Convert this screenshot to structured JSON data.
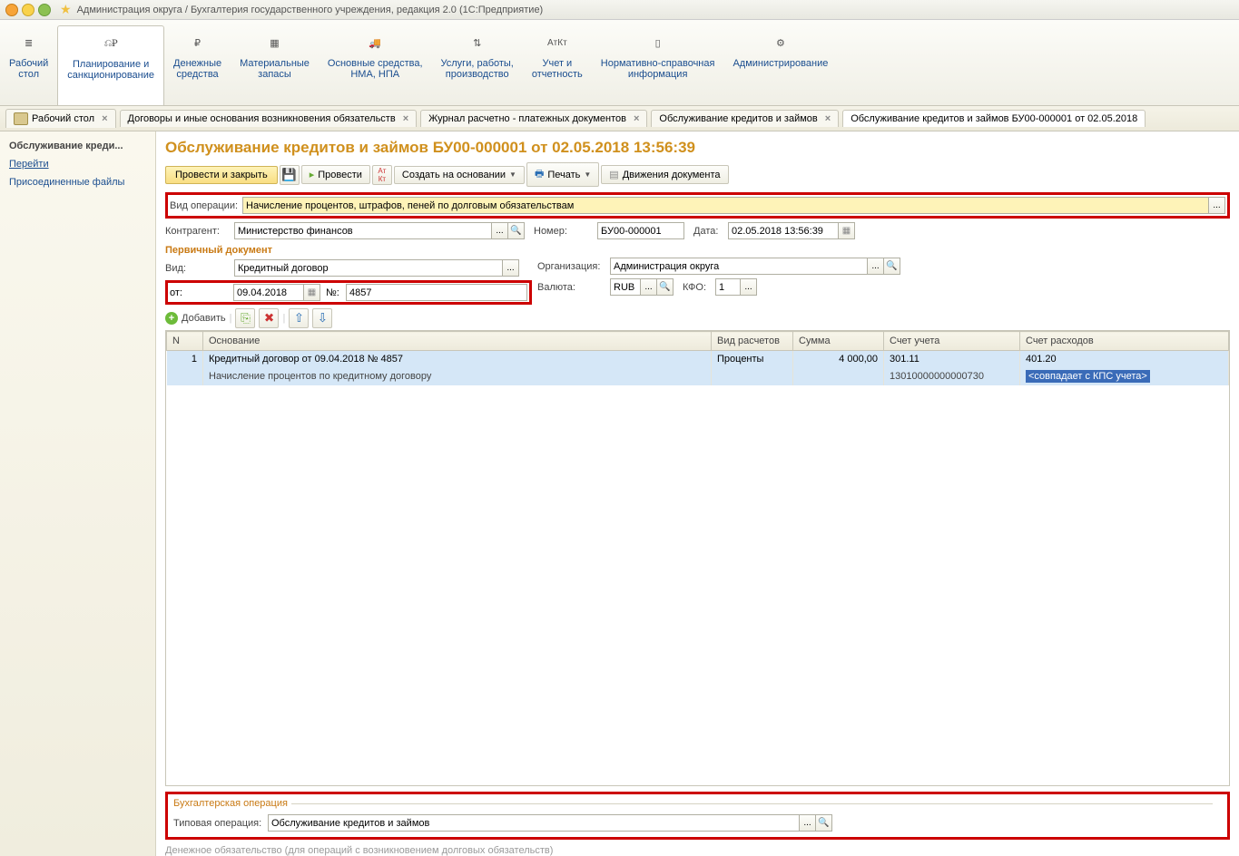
{
  "titlebar": {
    "text": "Администрация округа / Бухгалтерия государственного учреждения, редакция 2.0  (1С:Предприятие)"
  },
  "ribbon": [
    {
      "label": "Рабочий\nстол"
    },
    {
      "label": "Планирование и\nсанкционирование"
    },
    {
      "label": "Денежные\nсредства"
    },
    {
      "label": "Материальные\nзапасы"
    },
    {
      "label": "Основные средства,\nНМА, НПА"
    },
    {
      "label": "Услуги, работы,\nпроизводство"
    },
    {
      "label": "Учет и\nотчетность"
    },
    {
      "label": "Нормативно-справочная\nинформация"
    },
    {
      "label": "Администрирование"
    }
  ],
  "tabs": [
    {
      "label": "Рабочий стол"
    },
    {
      "label": "Договоры и иные основания возникновения обязательств"
    },
    {
      "label": "Журнал расчетно - платежных документов"
    },
    {
      "label": "Обслуживание кредитов и займов"
    },
    {
      "label": "Обслуживание кредитов и займов БУ00-000001 от 02.05.2018"
    }
  ],
  "sidebar": {
    "header": "Обслуживание креди...",
    "link1": "Перейти",
    "link2": "Присоединенные файлы"
  },
  "page": {
    "title": "Обслуживание кредитов и займов БУ00-000001 от 02.05.2018 13:56:39",
    "toolbar": {
      "post_close": "Провести и закрыть",
      "post": "Провести",
      "create_on_basis": "Создать на основании",
      "print": "Печать",
      "movements": "Движения документа"
    },
    "labels": {
      "op_type": "Вид операции:",
      "contractor": "Контрагент:",
      "number": "Номер:",
      "date": "Дата:",
      "primary_doc": "Первичный документ",
      "kind": "Вид:",
      "org": "Организация:",
      "from": "от:",
      "n": "№:",
      "currency": "Валюта:",
      "kfo": "КФО:",
      "add": "Добавить",
      "acc_op": "Бухгалтерская операция",
      "typical_op": "Типовая операция:",
      "hint": "Денежное обязательство (для операций с возникновением долговых обязательств)"
    },
    "values": {
      "op_type": "Начисление процентов, штрафов, пеней по долговым обязательствам",
      "contractor": "Министерство финансов",
      "number": "БУ00-000001",
      "date": "02.05.2018 13:56:39",
      "kind": "Кредитный договор",
      "org": "Администрация округа",
      "from": "09.04.2018",
      "n": "4857",
      "currency": "RUB",
      "kfo": "1",
      "typical_op": "Обслуживание кредитов и займов"
    },
    "grid": {
      "headers": {
        "n": "N",
        "basis": "Основание",
        "calc_type": "Вид расчетов",
        "sum": "Сумма",
        "acct": "Счет учета",
        "exp_acct": "Счет расходов"
      },
      "rows": [
        {
          "n": "1",
          "basis": "Кредитный договор от 09.04.2018 № 4857",
          "calc_type": "Проценты",
          "sum": "4 000,00",
          "acct": "301.11",
          "exp_acct": "401.20"
        },
        {
          "basis": "Начисление процентов по кредитному договору",
          "acct": "13010000000000730",
          "exp_acct": "<совпадает с КПС учета>"
        }
      ]
    }
  }
}
